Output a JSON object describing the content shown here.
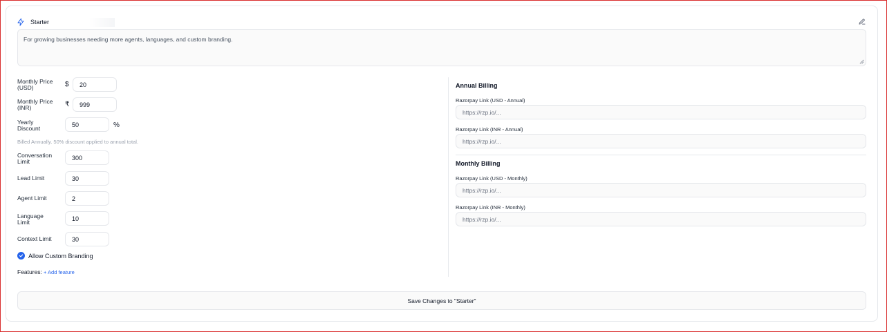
{
  "plan": {
    "name": "Starter",
    "description": "For growing businesses needing more agents, languages, and custom branding."
  },
  "pricing": {
    "monthly_usd_label": "Monthly Price (USD)",
    "usd_symbol": "$",
    "monthly_usd_value": "20",
    "monthly_inr_label": "Monthly Price (INR)",
    "inr_symbol": "₹",
    "monthly_inr_value": "999",
    "yearly_discount_label": "Yearly Discount",
    "yearly_discount_value": "50",
    "percent_symbol": "%",
    "billing_hint": "Billed Annually. 50% discount applied to annual total."
  },
  "limits": {
    "conversation_label": "Conversation Limit",
    "conversation_value": "300",
    "lead_label": "Lead Limit",
    "lead_value": "30",
    "agent_label": "Agent Limit",
    "agent_value": "2",
    "language_label": "Language Limit",
    "language_value": "10",
    "context_label": "Context Limit",
    "context_value": "30"
  },
  "branding": {
    "label": "Allow Custom Branding",
    "checked": true
  },
  "features": {
    "label": "Features:",
    "add_label": "+ Add feature"
  },
  "annual": {
    "title": "Annual Billing",
    "usd_label": "Razorpay Link (USD - Annual)",
    "usd_placeholder": "https://rzp.io/...",
    "inr_label": "Razorpay Link (INR - Annual)",
    "inr_placeholder": "https://rzp.io/..."
  },
  "monthly": {
    "title": "Monthly Billing",
    "usd_label": "Razorpay Link (USD - Monthly)",
    "usd_placeholder": "https://rzp.io/...",
    "inr_label": "Razorpay Link (INR - Monthly)",
    "inr_placeholder": "https://rzp.io/..."
  },
  "save_button": "Save Changes to \"Starter\"",
  "colors": {
    "accent": "#2563eb",
    "frame_border": "#d92c2c",
    "border": "#e5e7eb"
  }
}
